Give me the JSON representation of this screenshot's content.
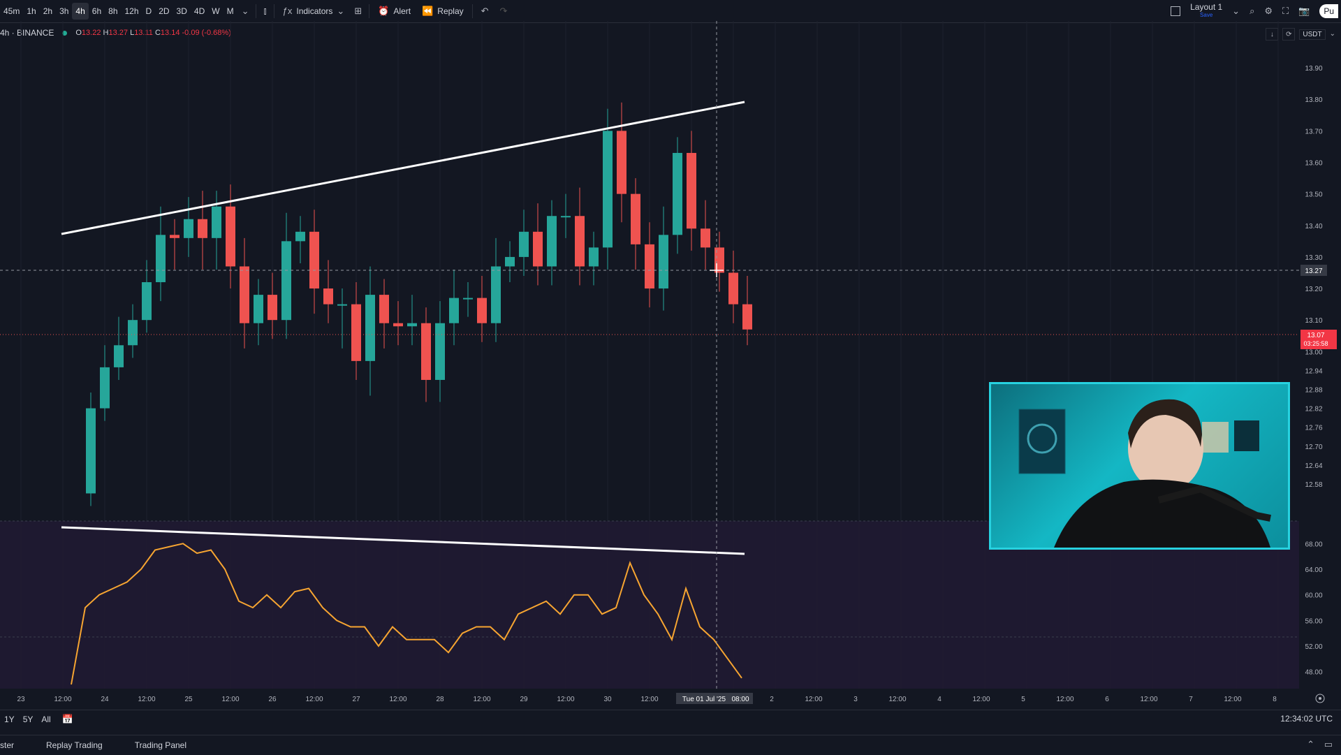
{
  "toolbar": {
    "timeframes": [
      "45m",
      "1h",
      "2h",
      "3h",
      "4h",
      "6h",
      "8h",
      "12h",
      "D",
      "2D",
      "3D",
      "4D",
      "W",
      "M"
    ],
    "active_timeframe": "4h",
    "indicators_label": "Indicators",
    "alert_label": "Alert",
    "replay_label": "Replay",
    "layout_label": "Layout 1",
    "layout_sub": "Save",
    "publish_label": "Pu"
  },
  "legend": {
    "symbol": "4h · BINANCE",
    "open_label": "O",
    "open": "13.22",
    "high_label": "H",
    "high": "13.27",
    "low_label": "L",
    "low": "13.11",
    "close_label": "C",
    "close": "13.14",
    "change": "-0.09 (-0.68%)"
  },
  "currency": "USDT",
  "price_axis": {
    "ticks": [
      "13.90",
      "13.80",
      "13.70",
      "13.60",
      "13.50",
      "13.40",
      "13.30",
      "13.20",
      "13.10",
      "13.00",
      "12.94",
      "12.88",
      "12.82",
      "12.76",
      "12.70",
      "12.64",
      "12.58"
    ],
    "crosshair_price": "13.27",
    "last_price": "13.07",
    "countdown": "03:25:58"
  },
  "rsi_axis": {
    "ticks": [
      "68.00",
      "64.00",
      "60.00",
      "56.00",
      "52.00",
      "48.00"
    ]
  },
  "time_axis": {
    "labels": [
      "23",
      "12:00",
      "24",
      "12:00",
      "25",
      "12:00",
      "26",
      "12:00",
      "27",
      "12:00",
      "28",
      "12:00",
      "29",
      "12:00",
      "30",
      "12:00",
      "2",
      "12:00",
      "3",
      "12:00",
      "4",
      "12:00",
      "5",
      "12:00",
      "6",
      "12:00",
      "7",
      "12:00",
      "8"
    ],
    "crosshair_label": "Tue 01 Jul '25",
    "crosshair_time": "08:00"
  },
  "ranges": [
    "1Y",
    "5Y",
    "All"
  ],
  "clock": "12:34:02 UTC",
  "footer_tabs": [
    "ster",
    "Replay Trading",
    "Trading Panel"
  ],
  "colors": {
    "bg": "#131722",
    "up": "#26a69a",
    "down": "#ef5350",
    "rsi": "#f7a531",
    "trendline": "#ffffff",
    "webcam_border": "#27d2e0"
  },
  "chart_data": {
    "type": "candlestick",
    "price_range": [
      12.52,
      13.96
    ],
    "candles": [
      [
        12.55,
        12.82,
        12.55,
        12.82
      ],
      [
        12.82,
        12.95,
        12.82,
        12.95
      ],
      [
        12.95,
        13.02,
        12.95,
        13.02
      ],
      [
        13.02,
        13.1,
        13.02,
        13.1
      ],
      [
        13.1,
        13.22,
        13.1,
        13.22
      ],
      [
        13.22,
        13.37,
        13.2,
        13.37
      ],
      [
        13.37,
        13.36,
        13.3,
        13.36
      ],
      [
        13.36,
        13.42,
        13.34,
        13.42
      ],
      [
        13.42,
        13.36,
        13.3,
        13.36
      ],
      [
        13.36,
        13.46,
        13.3,
        13.46
      ],
      [
        13.46,
        13.27,
        13.24,
        13.27
      ],
      [
        13.27,
        13.09,
        13.05,
        13.09
      ],
      [
        13.09,
        13.18,
        13.06,
        13.18
      ],
      [
        13.18,
        13.1,
        13.08,
        13.1
      ],
      [
        13.1,
        13.35,
        13.08,
        13.35
      ],
      [
        13.35,
        13.38,
        13.32,
        13.38
      ],
      [
        13.38,
        13.2,
        13.16,
        13.2
      ],
      [
        13.2,
        13.15,
        13.13,
        13.15
      ],
      [
        13.15,
        13.15,
        13.05,
        13.15
      ],
      [
        13.15,
        12.97,
        12.95,
        12.97
      ],
      [
        12.97,
        13.18,
        12.9,
        13.18
      ],
      [
        13.18,
        13.09,
        13.05,
        13.09
      ],
      [
        13.09,
        13.08,
        13.06,
        13.08
      ],
      [
        13.08,
        13.09,
        13.06,
        13.09
      ],
      [
        13.09,
        12.91,
        12.88,
        12.91
      ],
      [
        12.91,
        13.09,
        12.88,
        13.09
      ],
      [
        13.09,
        13.17,
        13.06,
        13.17
      ],
      [
        13.17,
        13.17,
        13.15,
        13.17
      ],
      [
        13.17,
        13.09,
        13.07,
        13.09
      ],
      [
        13.09,
        13.27,
        13.07,
        13.27
      ],
      [
        13.27,
        13.3,
        13.26,
        13.3
      ],
      [
        13.3,
        13.38,
        13.28,
        13.38
      ],
      [
        13.38,
        13.27,
        13.25,
        13.27
      ],
      [
        13.27,
        13.43,
        13.25,
        13.43
      ],
      [
        13.43,
        13.43,
        13.4,
        13.43
      ],
      [
        13.43,
        13.27,
        13.25,
        13.27
      ],
      [
        13.27,
        13.33,
        13.25,
        13.33
      ],
      [
        13.33,
        13.7,
        13.3,
        13.7
      ],
      [
        13.7,
        13.5,
        13.45,
        13.5
      ],
      [
        13.5,
        13.34,
        13.3,
        13.34
      ],
      [
        13.34,
        13.2,
        13.18,
        13.2
      ],
      [
        13.2,
        13.37,
        13.17,
        13.37
      ],
      [
        13.37,
        13.63,
        13.35,
        13.63
      ],
      [
        13.63,
        13.39,
        13.36,
        13.39
      ],
      [
        13.39,
        13.33,
        13.3,
        13.33
      ],
      [
        13.33,
        13.25,
        13.23,
        13.25
      ],
      [
        13.25,
        13.15,
        13.13,
        13.15
      ],
      [
        13.15,
        13.07,
        13.06,
        13.07
      ]
    ],
    "rsi_range": [
      46,
      70
    ],
    "rsi": [
      46,
      58,
      60,
      61,
      62,
      64,
      67,
      67.5,
      68,
      66.5,
      67,
      64,
      59,
      58,
      60,
      58,
      60.5,
      61,
      58,
      56,
      55,
      55,
      52,
      55,
      53,
      53,
      53,
      51,
      54,
      55,
      55,
      53,
      57,
      58,
      59,
      57,
      60,
      60,
      57,
      58,
      65,
      60,
      57,
      53,
      61,
      55,
      53,
      50,
      47
    ]
  }
}
